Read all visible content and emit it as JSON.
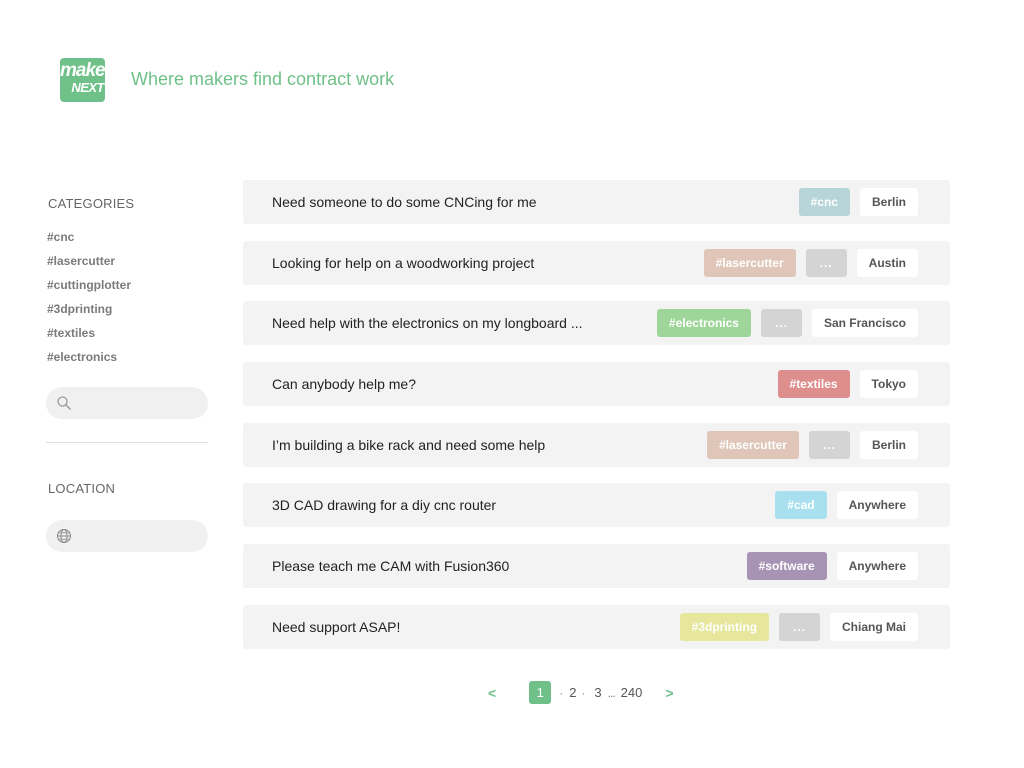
{
  "header": {
    "logo_line1": "make",
    "logo_line2": "NEXT",
    "tagline": "Where makers find contract work"
  },
  "sidebar": {
    "categories_title": "CATEGORIES",
    "categories": [
      "#cnc",
      "#lasercutter",
      "#cuttingplotter",
      "#3dprinting",
      "#textiles",
      "#electronics"
    ],
    "category_search": {
      "value": "",
      "placeholder": ""
    },
    "location_title": "LOCATION",
    "location_search": {
      "value": "",
      "placeholder": ""
    }
  },
  "listings": [
    {
      "title": "Need someone to do some CNCing for me",
      "tag": "#cnc",
      "tag_color": "#b7d5d8",
      "more": "",
      "location": "Berlin"
    },
    {
      "title": "Looking for help on a woodworking project",
      "tag": "#lasercutter",
      "tag_color": "#dfc6b8",
      "more": "...",
      "location": "Austin"
    },
    {
      "title": "Need help with the electronics on my longboard ...",
      "tag": "#electronics",
      "tag_color": "#9ed69a",
      "more": "...",
      "location": "San Francisco"
    },
    {
      "title": "Can anybody help me?",
      "tag": "#textiles",
      "tag_color": "#df8e8e",
      "more": "",
      "location": "Tokyo"
    },
    {
      "title": "I’m building a bike rack and need some help",
      "tag": "#lasercutter",
      "tag_color": "#dfc6b8",
      "more": "...",
      "location": "Berlin"
    },
    {
      "title": "3D CAD drawing for a diy cnc router",
      "tag": "#cad",
      "tag_color": "#a8e0ef",
      "more": "",
      "location": "Anywhere"
    },
    {
      "title": "Please teach me CAM with Fusion360",
      "tag": "#software",
      "tag_color": "#a793b3",
      "more": "",
      "location": "Anywhere"
    },
    {
      "title": "Need support ASAP!",
      "tag": "#3dprinting",
      "tag_color": "#e6e69c",
      "more": "...",
      "location": "Chiang Mai"
    }
  ],
  "pagination": {
    "prev": "<",
    "next": ">",
    "current": "1",
    "pages": [
      "2",
      "3"
    ],
    "ellipsis": "...",
    "last": "240"
  },
  "colors": {
    "brand": "#6fc089",
    "row_background": "#f3f3f3",
    "more_chip": "#d4d4d4"
  }
}
